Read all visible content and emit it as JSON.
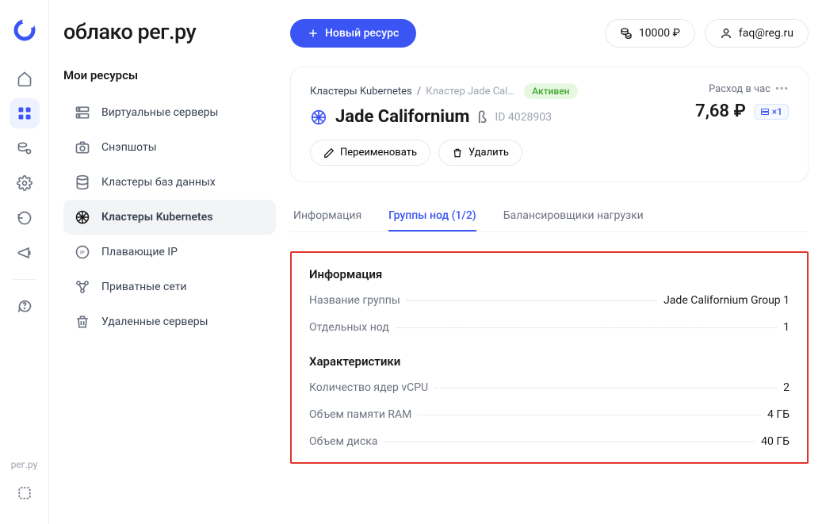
{
  "brand": "облако рег.ру",
  "rail": {
    "footer_text": "рег.ру"
  },
  "sidebar": {
    "title": "Мои ресурсы",
    "items": [
      {
        "label": "Виртуальные серверы"
      },
      {
        "label": "Снэпшоты"
      },
      {
        "label": "Кластеры баз данных"
      },
      {
        "label": "Кластеры Kubernetes"
      },
      {
        "label": "Плавающие IP"
      },
      {
        "label": "Приватные сети"
      },
      {
        "label": "Удаленные серверы"
      }
    ]
  },
  "topbar": {
    "new_resource": "Новый ресурс",
    "balance": "10000 ₽",
    "account": "faq@reg.ru"
  },
  "cluster": {
    "breadcrumb_root": "Кластеры Kubernetes",
    "breadcrumb_sep": "/",
    "breadcrumb_current": "Кластер Jade Cal…",
    "status": "Активен",
    "cost_label": "Расход в час",
    "cost_value": "7,68 ₽",
    "server_chip": "×1",
    "name": "Jade Californium",
    "beta": "ß",
    "id_label": "ID 4028903",
    "rename": "Переименовать",
    "delete": "Удалить"
  },
  "tabs": {
    "info": "Информация",
    "groups": "Группы нод (1/2)",
    "balancers": "Балансировщики нагрузки"
  },
  "panel": {
    "info_title": "Информация",
    "group_name_label": "Название группы",
    "group_name_value": "Jade Californium Group 1",
    "nodes_label": "Отдельных нод",
    "nodes_value": "1",
    "specs_title": "Характеристики",
    "vcpu_label": "Количество ядер vCPU",
    "vcpu_value": "2",
    "ram_label": "Объем памяти RAM",
    "ram_value": "4 ГБ",
    "disk_label": "Объем диска",
    "disk_value": "40 ГБ"
  }
}
